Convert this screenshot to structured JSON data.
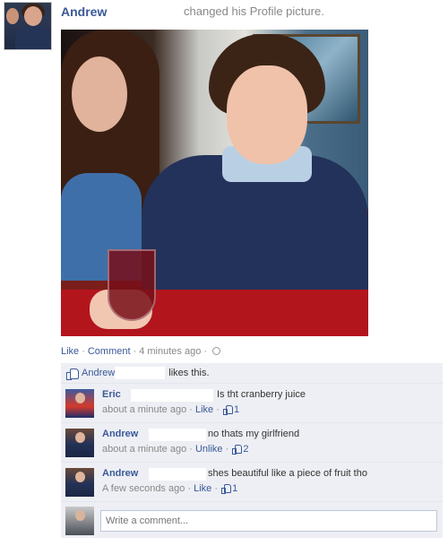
{
  "post": {
    "poster_name": "Andrew",
    "story_text": "changed his Profile picture."
  },
  "actions": {
    "like": "Like",
    "comment": "Comment",
    "time": "4 minutes ago"
  },
  "likes": {
    "name": "Andrew",
    "text": "likes this."
  },
  "comments": [
    {
      "name": "Eric",
      "text": "Is tht cranberry juice",
      "time": "about a minute ago",
      "action": "Like",
      "like_count": "1"
    },
    {
      "name": "Andrew",
      "text": "no thats my girlfriend",
      "time": "about a minute ago",
      "action": "Unlike",
      "like_count": "2"
    },
    {
      "name": "Andrew",
      "text": "shes beautiful like a piece of fruit tho",
      "time": "A few seconds ago",
      "action": "Like",
      "like_count": "1"
    }
  ],
  "composer": {
    "placeholder": "Write a comment..."
  },
  "colors": {
    "link": "#3b5998",
    "feedback_bg": "#edeff4",
    "meta": "#888888"
  }
}
